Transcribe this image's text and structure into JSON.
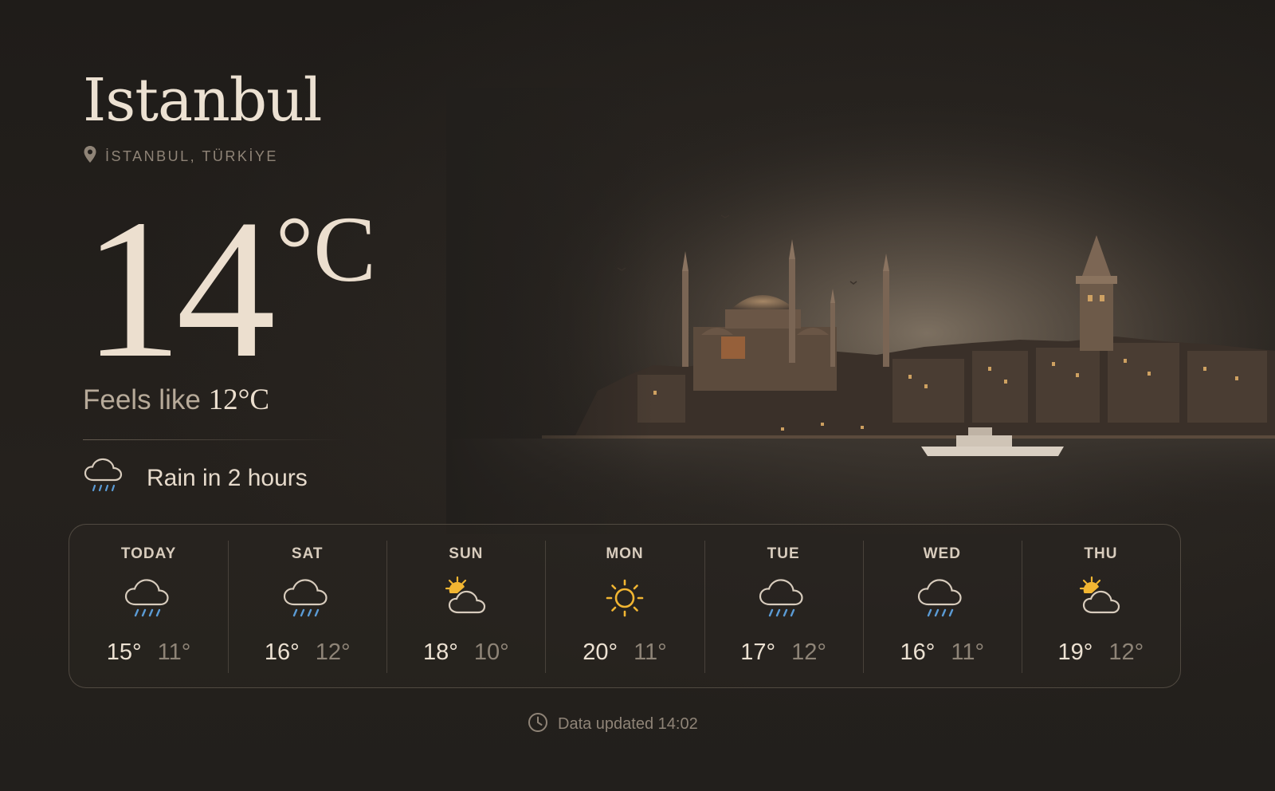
{
  "city": "Istanbul",
  "location": "İSTANBUL, TÜRKİYE",
  "current": {
    "temperature": "14",
    "unit": "°C",
    "feels_like_label": "Feels like",
    "feels_like_value": "12°C"
  },
  "alert": "Rain in 2 hours",
  "forecast": [
    {
      "day": "TODAY",
      "icon": "rain-icon",
      "hi": "15°",
      "lo": "11°"
    },
    {
      "day": "SAT",
      "icon": "rain-icon",
      "hi": "16°",
      "lo": "12°"
    },
    {
      "day": "SUN",
      "icon": "partly-cloudy-icon",
      "hi": "18°",
      "lo": "10°"
    },
    {
      "day": "MON",
      "icon": "sun-icon",
      "hi": "20°",
      "lo": "11°"
    },
    {
      "day": "TUE",
      "icon": "rain-icon",
      "hi": "17°",
      "lo": "12°"
    },
    {
      "day": "WED",
      "icon": "rain-icon",
      "hi": "16°",
      "lo": "11°"
    },
    {
      "day": "THU",
      "icon": "partly-cloudy-icon",
      "hi": "19°",
      "lo": "12°"
    }
  ],
  "updated": "Data updated 14:02",
  "colors": {
    "background": "#221f1c",
    "text_primary": "#ece1d2",
    "text_muted": "#8f8477",
    "sun": "#f2b632",
    "rain": "#5b9bd5"
  }
}
